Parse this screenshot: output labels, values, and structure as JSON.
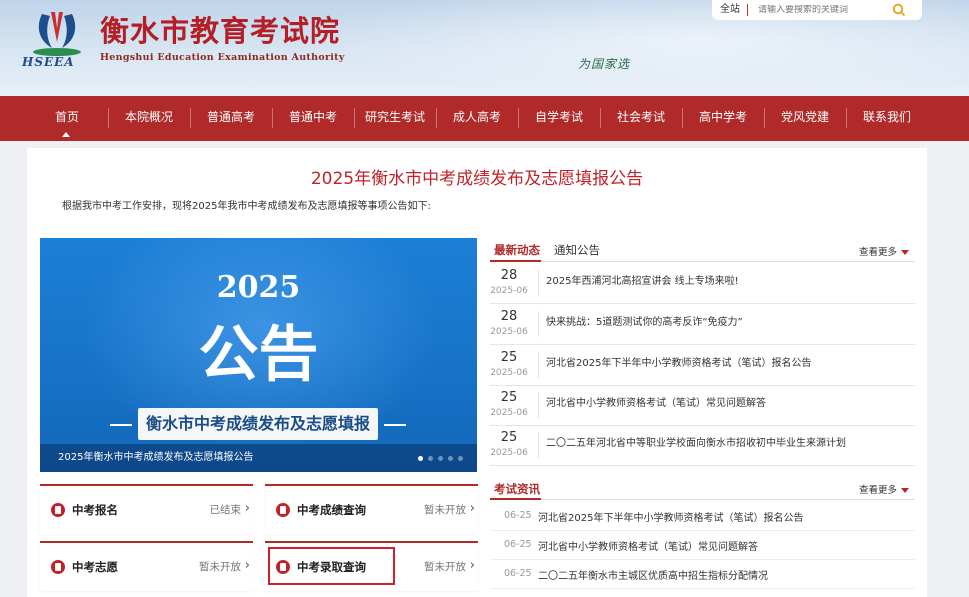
{
  "header": {
    "logo_abbr": "HSEEA",
    "title": "衡水市教育考试院",
    "subtitle": "Hengshui Education Examination Authority",
    "slogan": "为国家选",
    "search": {
      "scope": "全站",
      "placeholder": "请输入要搜索的关键词"
    }
  },
  "nav": {
    "items": [
      "首页",
      "本院概况",
      "普通高考",
      "普通中考",
      "研究生考试",
      "成人高考",
      "自学考试",
      "社会考试",
      "高中学考",
      "党风党建",
      "联系我们"
    ],
    "active": "首页"
  },
  "notice": {
    "title": "2025年衡水市中考成绩发布及志愿填报公告",
    "intro": "根据我市中考工作安排，现将2025年我市中考成绩发布及志愿填报等事项公告如下:"
  },
  "banner": {
    "year": "2025",
    "big": "公告",
    "box_text": "衡水市中考成绩发布及志愿填报",
    "caption": "2025年衡水市中考成绩发布及志愿填报公告",
    "slide_count": 5,
    "active_slide": 1
  },
  "quick_cards": [
    {
      "label": "中考报名",
      "status": "已结束"
    },
    {
      "label": "中考成绩查询",
      "status": "暂未开放"
    },
    {
      "label": "中考志愿",
      "status": "暂未开放"
    },
    {
      "label": "中考录取查询",
      "status": "暂未开放"
    }
  ],
  "news": {
    "tabs": [
      "最新动态",
      "通知公告"
    ],
    "more": "查看更多",
    "items": [
      {
        "day": "28",
        "ym": "2025-06",
        "title": "2025年西浦河北高招宣讲会 线上专场来啦!"
      },
      {
        "day": "28",
        "ym": "2025-06",
        "title": "快来挑战：5道题测试你的高考反诈“免疫力”"
      },
      {
        "day": "25",
        "ym": "2025-06",
        "title": "河北省2025年下半年中小学教师资格考试（笔试）报名公告"
      },
      {
        "day": "25",
        "ym": "2025-06",
        "title": "河北省中小学教师资格考试（笔试）常见问题解答"
      },
      {
        "day": "25",
        "ym": "2025-06",
        "title": "二〇二五年河北省中等职业学校面向衡水市招收初中毕业生来源计划"
      }
    ]
  },
  "exam_news": {
    "tab": "考试资讯",
    "more": "查看更多",
    "items": [
      {
        "date": "06-25",
        "title": "河北省2025年下半年中小学教师资格考试（笔试）报名公告"
      },
      {
        "date": "06-25",
        "title": "河北省中小学教师资格考试（笔试）常见问题解答"
      },
      {
        "date": "06-25",
        "title": "二〇二五年衡水市主城区优质高中招生指标分配情况"
      }
    ]
  },
  "colors": {
    "brand_red": "#b02a2a",
    "title_red": "#c0222a",
    "banner_blue": "#1672c7"
  }
}
